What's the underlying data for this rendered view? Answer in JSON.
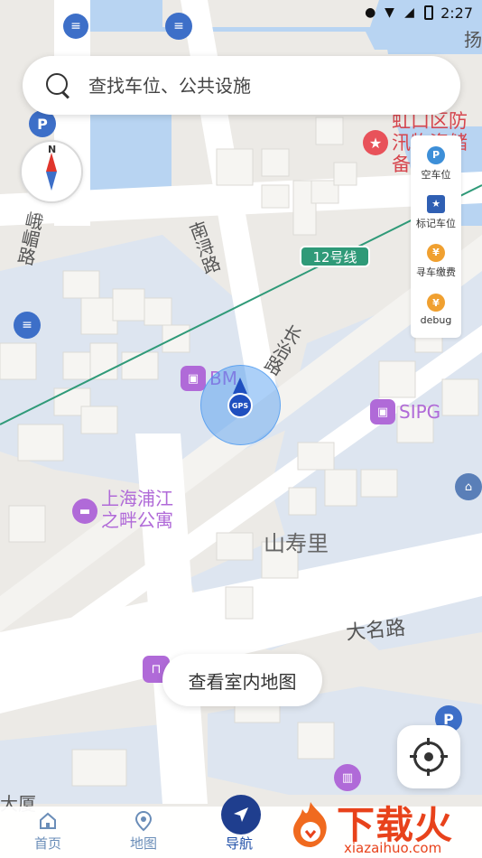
{
  "status_bar": {
    "time": "2:27"
  },
  "search": {
    "placeholder": "查找车位、公共设施"
  },
  "compass": {
    "north_label": "N"
  },
  "side_panel": {
    "items": [
      {
        "label": "空车位",
        "icon": "parking-pin-icon",
        "glyph": "P",
        "color": "#3d8fd8"
      },
      {
        "label": "标记车位",
        "icon": "flag-icon",
        "glyph": "★",
        "color": "#2f5fb3"
      },
      {
        "label": "寻车缴费",
        "icon": "yen-icon",
        "glyph": "¥",
        "color": "#f0a030"
      },
      {
        "label": "debug",
        "icon": "yen-icon",
        "glyph": "¥",
        "color": "#f0a030"
      }
    ]
  },
  "map": {
    "labels": {
      "district_poi": "虹口区防汛物资储备库",
      "metro_line": "12号线",
      "road_emei": "峨嵋路",
      "road_nanxun": "南浔路",
      "road_changzhi": "长治路",
      "road_daming": "大名路",
      "area_shanshouli": "山寿里",
      "poi_bm": "BM",
      "poi_sipg": "SIPG",
      "poi_apartment_line1": "上海浦江",
      "poi_apartment_line2": "之畔公寓",
      "poi_dasha": "大厦",
      "top_right_char": "扬"
    },
    "gps_label": "GPS"
  },
  "indoor_button": {
    "label": "查看室内地图"
  },
  "bottom_nav": {
    "items": [
      {
        "label": "首页",
        "icon": "home-icon"
      },
      {
        "label": "地图",
        "icon": "map-pin-icon"
      },
      {
        "label": "导航",
        "icon": "navigation-icon"
      }
    ]
  },
  "watermark": {
    "brand": "下载火",
    "domain": "xiazaihuo.com"
  },
  "colors": {
    "accent": "#1f4fa8",
    "metro_line": "#2f9a78",
    "poi_purple": "#b06ad8",
    "water": "#b8d4f2"
  }
}
